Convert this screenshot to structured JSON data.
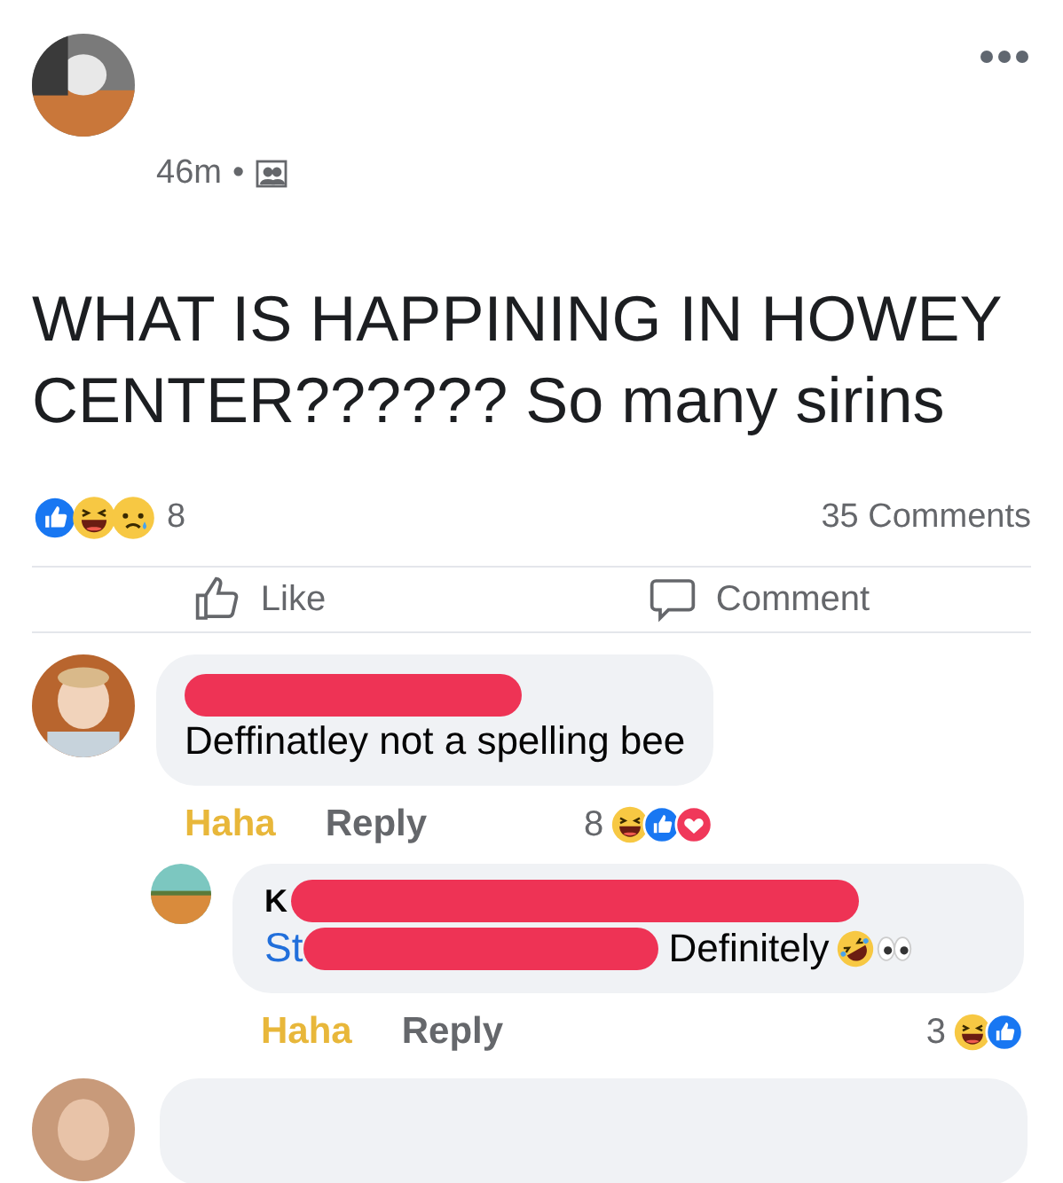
{
  "post": {
    "time": "46m",
    "separator": "•",
    "text": "WHAT IS HAPPINING IN HOWEY CENTER?????? So many sirins",
    "reactions": [
      {
        "kind": "like"
      },
      {
        "kind": "haha"
      },
      {
        "kind": "sad"
      }
    ],
    "reaction_count": "8",
    "comment_count": "35 Comments"
  },
  "actions": [
    {
      "kind": "like",
      "label": "Like"
    },
    {
      "kind": "comment",
      "label": "Comment"
    }
  ],
  "comments": [
    {
      "reply": false,
      "text": "Deffinatley not a spelling bee",
      "reaction_label": "Haha",
      "reacted": true,
      "reply_label": "Reply",
      "count": "8",
      "reactions": [
        {
          "kind": "haha"
        },
        {
          "kind": "like"
        },
        {
          "kind": "love"
        }
      ]
    },
    {
      "reply": true,
      "author_visible": "K",
      "mention_visible": "St",
      "text": "Definitely",
      "trailing_emoji": [
        {
          "kind": "rofl"
        },
        {
          "kind": "eyes"
        }
      ],
      "reaction_label": "Haha",
      "reacted": true,
      "reply_label": "Reply",
      "count": "3",
      "reactions": [
        {
          "kind": "haha"
        },
        {
          "kind": "like"
        }
      ]
    }
  ]
}
